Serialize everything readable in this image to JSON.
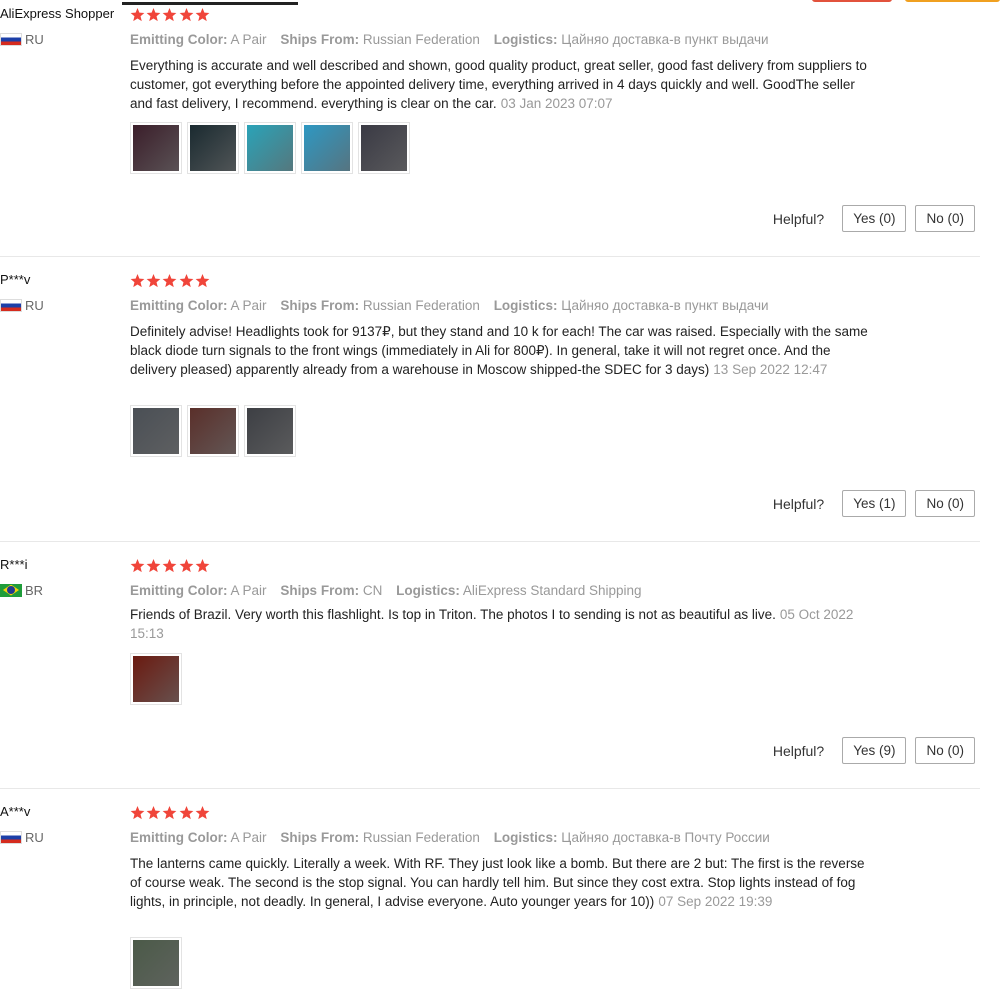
{
  "reviews": [
    {
      "user": "AliExpress Shopper",
      "country_code": "RU",
      "flag": "flag-russia",
      "rating": 5,
      "attrs": {
        "emitting_color_key": "Emitting Color:",
        "emitting_color": "A Pair",
        "ships_from_key": "Ships From:",
        "ships_from": "Russian Federation",
        "logistics_key": "Logistics:",
        "logistics": "Цайняо доставка-в пункт выдачи"
      },
      "text": "Everything is accurate and well described and shown, good quality product, great seller, good fast delivery from suppliers to customer, got everything before the appointed delivery time, everything arrived in 4 days quickly and well. GoodThe seller and fast delivery, I recommend. everything is clear on the car.",
      "date": "03 Jan 2023 07:07",
      "photos": [
        {
          "name": "review-photo-headlight-dark",
          "color": "#3b1e2a"
        },
        {
          "name": "review-photo-headlight-box",
          "color": "#1a2a30"
        },
        {
          "name": "review-photo-package-box",
          "color": "#2aa3b8"
        },
        {
          "name": "review-photo-bubble-wrap",
          "color": "#2e98c2"
        },
        {
          "name": "review-photo-headlight-wrapped",
          "color": "#3a3a44"
        }
      ],
      "helpful_label": "Helpful?",
      "yes_label": "Yes (0)",
      "no_label": "No (0)"
    },
    {
      "user": "P***v",
      "country_code": "RU",
      "flag": "flag-russia",
      "rating": 5,
      "attrs": {
        "emitting_color_key": "Emitting Color:",
        "emitting_color": "A Pair",
        "ships_from_key": "Ships From:",
        "ships_from": "Russian Federation",
        "logistics_key": "Logistics:",
        "logistics": "Цайняо доставка-в пункт выдачи"
      },
      "text": "Definitely advise! Headlights took for 9137₽, but they stand and 10 k for each! The car was raised. Especially with the same black diode turn signals to the front wings (immediately in Ali for 800₽). In general, take it will not regret once. And the delivery pleased) apparently already from a warehouse in Moscow shipped-the SDEC for 3 days)",
      "date": "13 Sep 2022 12:47",
      "photos": [
        {
          "name": "review-photo-truck-rear",
          "color": "#4a4f55"
        },
        {
          "name": "review-photo-taillight-on",
          "color": "#5a2f2a"
        },
        {
          "name": "review-photo-truck-side",
          "color": "#3d3f44"
        }
      ],
      "helpful_label": "Helpful?",
      "yes_label": "Yes (1)",
      "no_label": "No (0)"
    },
    {
      "user": "R***i",
      "country_code": "BR",
      "flag": "flag-brazil",
      "rating": 5,
      "attrs": {
        "emitting_color_key": "Emitting Color:",
        "emitting_color": "A Pair",
        "ships_from_key": "Ships From:",
        "ships_from": "CN",
        "logistics_key": "Logistics:",
        "logistics": "AliExpress Standard Shipping"
      },
      "text": "Friends of Brazil. Very worth this flashlight. Is top in Triton. The photos I to sending is not as beautiful as live.",
      "date": "05 Oct 2022 15:13",
      "photos": [
        {
          "name": "review-photo-taillight-night",
          "color": "#6b1a10"
        }
      ],
      "helpful_label": "Helpful?",
      "yes_label": "Yes (9)",
      "no_label": "No (0)"
    },
    {
      "user": "A***v",
      "country_code": "RU",
      "flag": "flag-russia",
      "rating": 5,
      "attrs": {
        "emitting_color_key": "Emitting Color:",
        "emitting_color": "A Pair",
        "ships_from_key": "Ships From:",
        "ships_from": "Russian Federation",
        "logistics_key": "Logistics:",
        "logistics": "Цайняо доставка-в Почту России"
      },
      "text": "The lanterns came quickly. Literally a week. With RF. They just look like a bomb. But there are 2 but: The first is the reverse of course weak. The second is the stop signal. You can hardly tell him. But since they cost extra. Stop lights instead of fog lights, in principle, not deadly. In general, I advise everyone. Auto younger years for 10))",
      "date": "07 Sep 2022 19:39",
      "photos": [
        {
          "name": "review-photo-truck-outdoor",
          "color": "#4b5a48"
        }
      ],
      "helpful_label": "",
      "yes_label": "",
      "no_label": ""
    }
  ],
  "colors": {
    "star": "#f0453a",
    "muted_text": "#999999",
    "body_text": "#222222",
    "divider": "#e8e8e8",
    "top_button_red": "#e2523c",
    "top_button_orange": "#f0a020"
  }
}
